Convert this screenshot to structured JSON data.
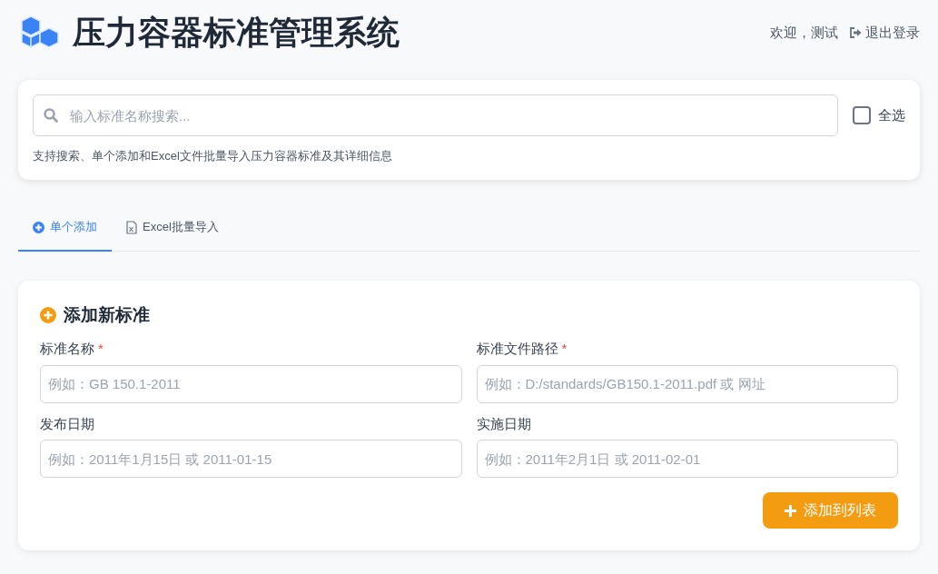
{
  "header": {
    "title": "压力容器标准管理系统",
    "welcome": "欢迎，测试",
    "logout": "退出登录"
  },
  "search": {
    "placeholder": "输入标准名称搜索...",
    "select_all": {
      "label": "全选",
      "checked": false
    },
    "hint": "支持搜索、单个添加和Excel文件批量导入压力容器标准及其详细信息"
  },
  "tabs": [
    {
      "label": "单个添加",
      "kind": "add",
      "selected": true
    },
    {
      "label": "Excel批量导入",
      "kind": "excel",
      "selected": false
    }
  ],
  "form": {
    "title": "添加新标准",
    "fields": [
      {
        "label": "标准名称",
        "required_mark": "*",
        "placeholder": "例如：GB 150.1-2011"
      },
      {
        "label": "标准文件路径",
        "required_mark": "*",
        "placeholder": "例如：D:/standards/GB150.1-2011.pdf 或 网址"
      },
      {
        "label": "发布日期",
        "placeholder": "例如：2011年1月15日 或 2011-01-15"
      },
      {
        "label": "实施日期",
        "placeholder": "例如：2011年2月1日 或 2011-02-01"
      }
    ],
    "submit": "添加到列表"
  }
}
